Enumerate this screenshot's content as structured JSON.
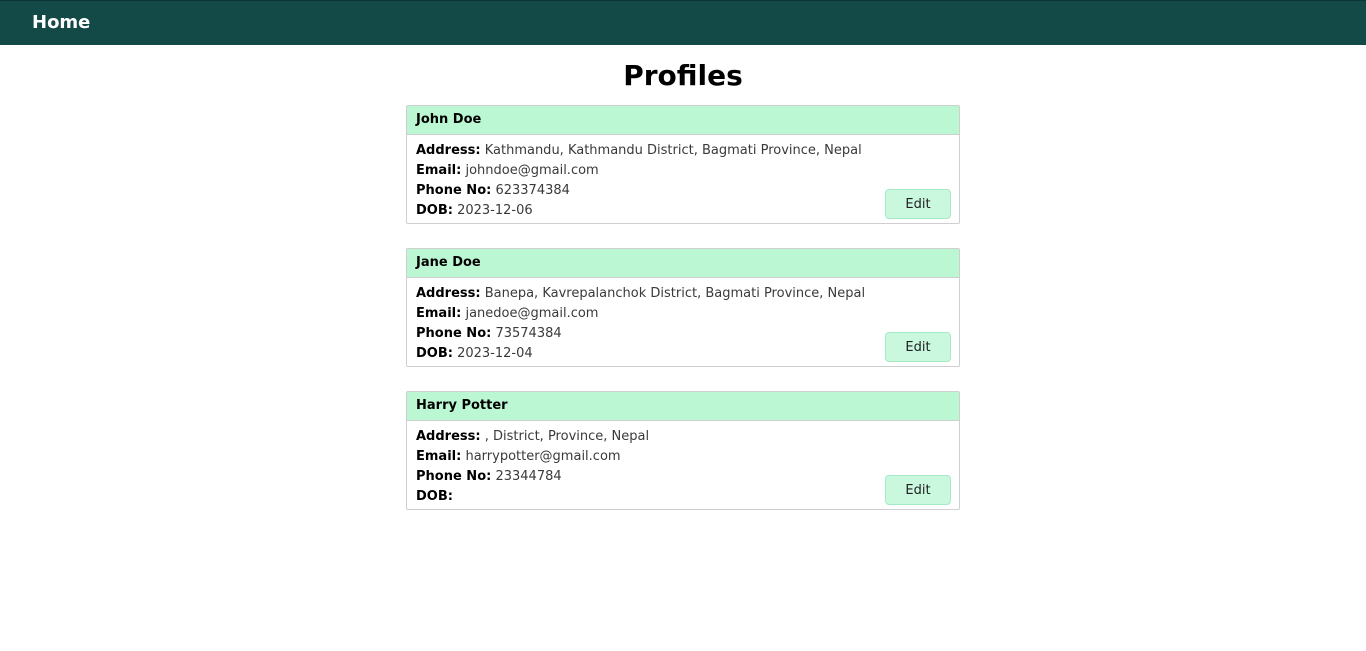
{
  "nav": {
    "home_label": "Home"
  },
  "page": {
    "title": "Profiles"
  },
  "labels": {
    "address": "Address:",
    "email": "Email:",
    "phone": "Phone No:",
    "dob": "DOB:",
    "edit": "Edit"
  },
  "profiles": [
    {
      "name": "John Doe",
      "address": "Kathmandu, Kathmandu District, Bagmati Province, Nepal",
      "email": "johndoe@gmail.com",
      "phone": "623374384",
      "dob": "2023-12-06"
    },
    {
      "name": "Jane Doe",
      "address": "Banepa, Kavrepalanchok District, Bagmati Province, Nepal",
      "email": "janedoe@gmail.com",
      "phone": "73574384",
      "dob": "2023-12-04"
    },
    {
      "name": "Harry Potter",
      "address": ", District, Province, Nepal",
      "email": "harrypotter@gmail.com",
      "phone": "23344784",
      "dob": ""
    }
  ],
  "colors": {
    "navbar": "#134a48",
    "card_header": "#bcf7d4",
    "edit_button": "#c9f8df"
  }
}
